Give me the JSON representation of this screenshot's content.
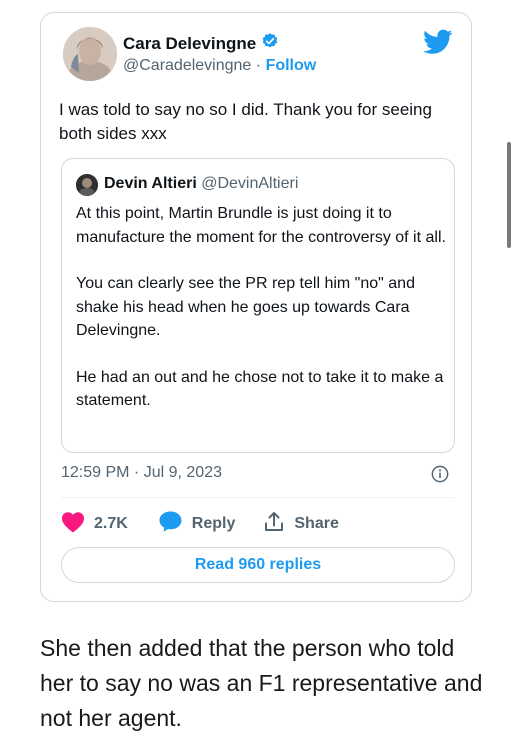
{
  "tweet": {
    "author_name": "Cara Delevingne",
    "author_handle": "@Caradelevingne",
    "separator": "·",
    "follow_label": "Follow",
    "text": "I was told to say no so I did. Thank you for seeing both sides xxx",
    "timestamp": "12:59 PM · Jul 9, 2023",
    "likes": "2.7K",
    "reply_label": "Reply",
    "share_label": "Share",
    "read_replies_label": "Read 960 replies"
  },
  "quoted": {
    "author_name": "Devin Altieri",
    "author_handle": "@DevinAltieri",
    "paragraphs": [
      "At this point, Martin Brundle is just doing it to manufacture the moment for the controversy of it all.",
      "You can clearly see the PR rep tell him \"no\" and shake his head when he goes up towards Cara Delevingne.",
      "He had an out and he chose not to take it to make a statement."
    ]
  },
  "caption": "She then added that the person who told her to say no was an F1 representative and not her agent.",
  "icons": {
    "verified": "verified-badge-icon",
    "logo": "twitter-bird-icon",
    "info": "info-icon",
    "like": "heart-icon",
    "reply": "reply-bubble-icon",
    "share": "share-icon"
  },
  "colors": {
    "accent": "#1d9bf0",
    "like": "#f91880",
    "muted": "#536471",
    "border": "#cfd9de"
  }
}
